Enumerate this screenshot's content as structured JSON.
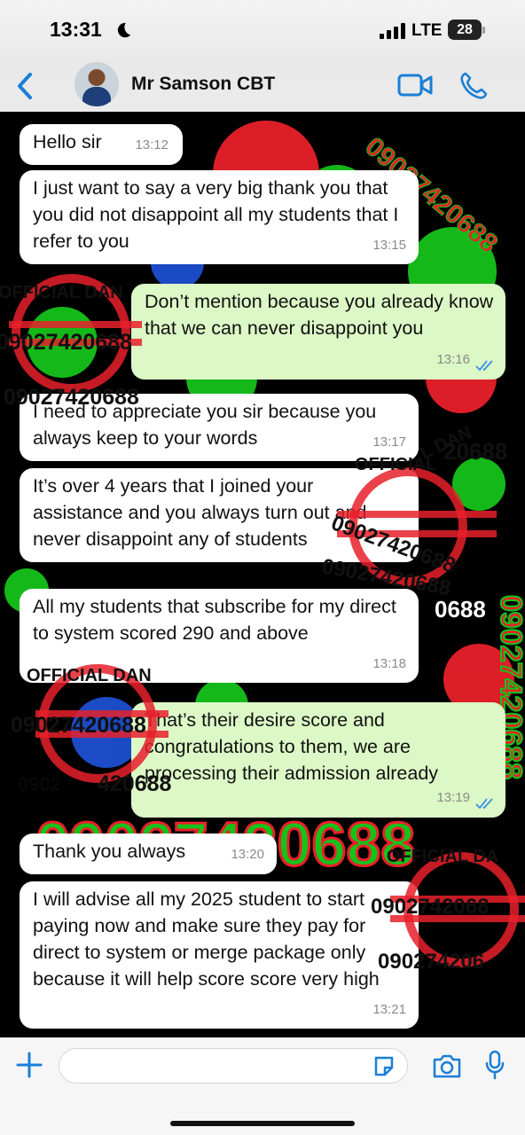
{
  "status_bar": {
    "time": "13:31",
    "network": "LTE",
    "battery": "28"
  },
  "header": {
    "contact_name": "Mr Samson CBT",
    "back_icon": "chevron-left-icon",
    "video_icon": "video-camera-icon",
    "call_icon": "phone-icon",
    "accent_color": "#1a7fd6"
  },
  "messages": [
    {
      "direction": "in",
      "text": "Hello sir",
      "time": "13:12"
    },
    {
      "direction": "in",
      "text": "I just want to say a very big thank you that you did not disappoint all my students that I refer to you",
      "time": "13:15"
    },
    {
      "direction": "out",
      "text": "Don’t mention because you already know that we can never disappoint you",
      "time": "13:16",
      "status": "read"
    },
    {
      "direction": "in",
      "text": "I need to appreciate you sir because you always keep to your words",
      "time": "13:17"
    },
    {
      "direction": "in",
      "text": "It’s over 4 years that I joined your assistance and you always turn out and never disappoint any of students",
      "time": ""
    },
    {
      "direction": "in",
      "text": "All my students that subscribe for my direct to system scored 290 and above",
      "time": "13:18"
    },
    {
      "direction": "out",
      "text": "That’s their desire score and congratulations to them, we are processing their admission already",
      "time": "13:19",
      "status": "read"
    },
    {
      "direction": "in",
      "text": "Thank you always",
      "time": "13:20"
    },
    {
      "direction": "in",
      "text": "I will advise all my 2025 student to start paying now and make sure they pay for direct to system or merge package only because it will help score score very high",
      "time": "13:21"
    }
  ],
  "watermarks": {
    "name": "OFFICIAL DAN",
    "phone": "09027420688",
    "name_partial": "OFFICIAL DA",
    "phone_partial": "0902742068",
    "name_short": "OFFICIAL",
    "name_tail": "L DAN",
    "phone_fragment_a": "20688",
    "phone_fragment_b": "0688",
    "phone_fragment_c": "420688",
    "phone_fragment_d": "0902",
    "phone_fragment_e": "090274206",
    "phone_fragment_f": "090",
    "big_background": "09027420688",
    "stamp_red": "#e8202a",
    "green": "#16c21a"
  },
  "input_bar": {
    "placeholder": "",
    "plus_icon": "plus-icon",
    "sticker_icon": "sticker-icon",
    "camera_icon": "camera-icon",
    "mic_icon": "microphone-icon"
  }
}
